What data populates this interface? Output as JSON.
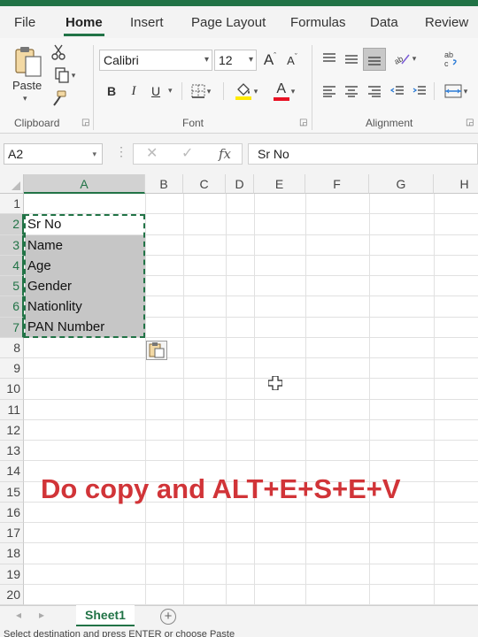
{
  "tabs": [
    "File",
    "Home",
    "Insert",
    "Page Layout",
    "Formulas",
    "Data",
    "Review"
  ],
  "ribbon": {
    "clipboard": {
      "label": "Clipboard",
      "paste_label": "Paste"
    },
    "font": {
      "label": "Font",
      "font_name": "Calibri",
      "font_size": "12",
      "bold": "B",
      "italic": "I",
      "underline": "U",
      "grow": "A",
      "shrink": "A",
      "color_letter": "A"
    },
    "alignment": {
      "label": "Alignment"
    }
  },
  "formula_bar": {
    "name_box": "A2",
    "fx": "fx",
    "value": "Sr No"
  },
  "columns": [
    "A",
    "B",
    "C",
    "D",
    "E",
    "F",
    "G",
    "H"
  ],
  "rows": [
    "1",
    "2",
    "3",
    "4",
    "5",
    "6",
    "7",
    "8",
    "9",
    "10",
    "11",
    "12",
    "13",
    "14",
    "15",
    "16",
    "17",
    "18",
    "19",
    "20"
  ],
  "cells": [
    "Sr No",
    "Name",
    "Age",
    "Gender",
    "Nationlity",
    "PAN Number"
  ],
  "overlay_text": "Do copy and ALT+E+S+E+V",
  "sheet": {
    "name": "Sheet1",
    "add": "+"
  },
  "status_text": "Select destination and press ENTER or choose Paste",
  "colors": {
    "accent": "#217346",
    "overlay": "#d13438",
    "selection": "#c6c6c6"
  }
}
